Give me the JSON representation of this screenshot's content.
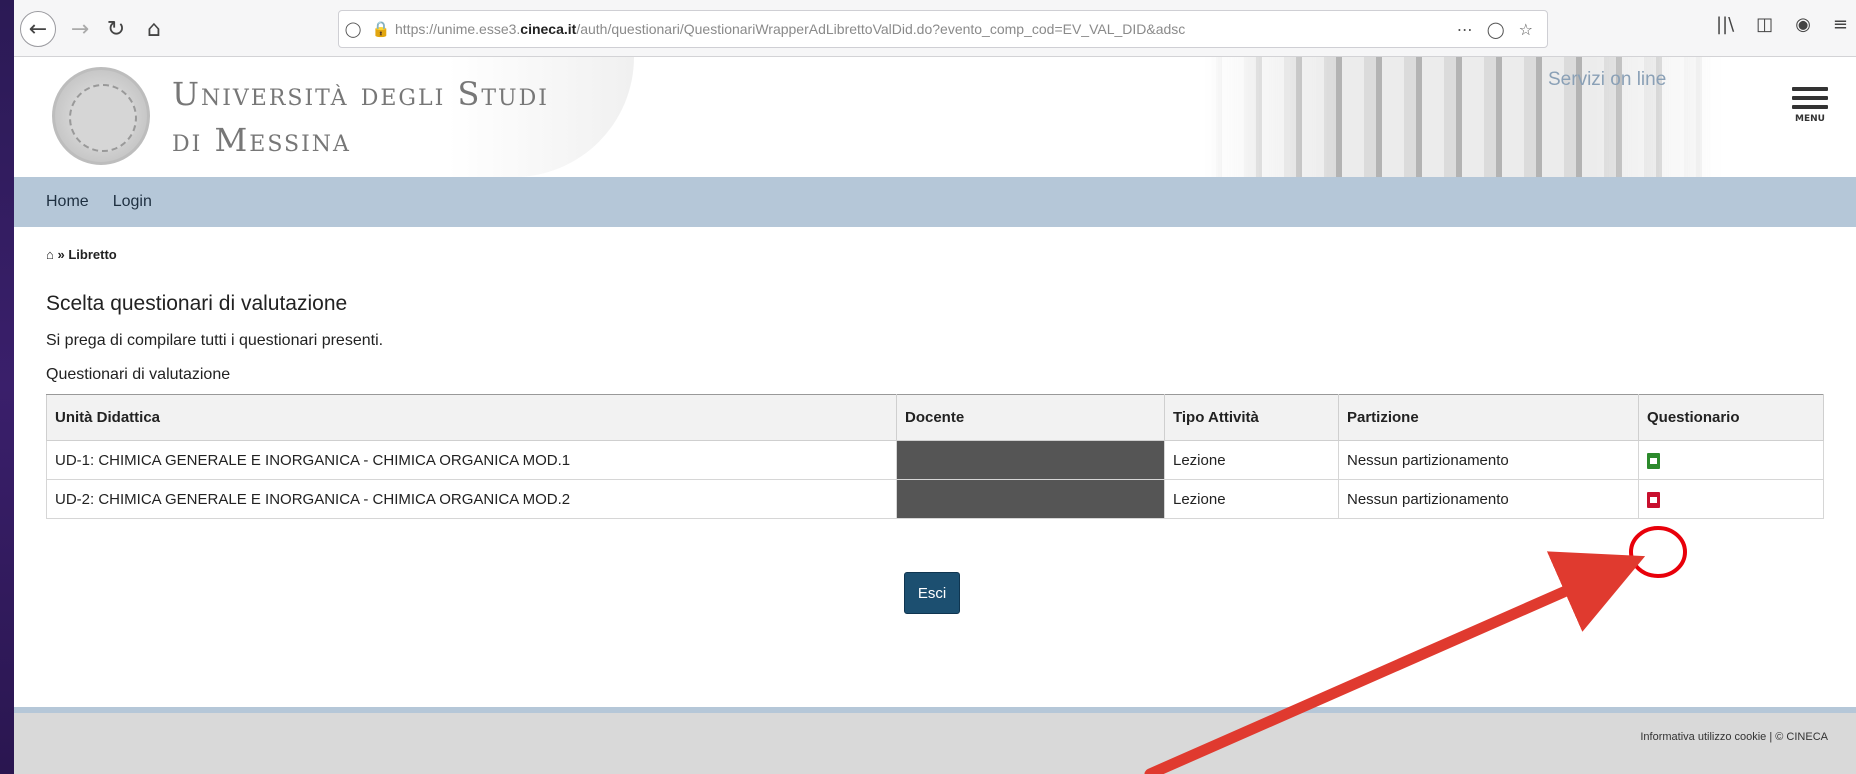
{
  "browser": {
    "url_prefix": "https://unime.esse3.",
    "url_domain": "cineca.it",
    "url_suffix": "/auth/questionari/QuestionariWrapperAdLibrettoValDid.do?evento_comp_cod=EV_VAL_DID&adsc",
    "icons": [
      "back-icon",
      "forward-icon",
      "reload-icon",
      "home-icon",
      "shield-icon",
      "lock-icon",
      "more-icon",
      "pocket-icon",
      "star-icon",
      "library-icon",
      "sidebar-icon",
      "account-icon",
      "hamburger-icon"
    ]
  },
  "header": {
    "univ_line1": "Università degli Studi",
    "univ_line2": "di Messina",
    "servizi": "Servizi on line",
    "menu_label": "MENU"
  },
  "nav": {
    "home": "Home",
    "login": "Login"
  },
  "breadcrumb": {
    "sep": "»",
    "current": "Libretto"
  },
  "main": {
    "title": "Scelta questionari di valutazione",
    "subtitle": "Si prega di compilare tutti i questionari presenti.",
    "section_label": "Questionari di valutazione",
    "table": {
      "headers": [
        "Unità Didattica",
        "Docente",
        "Tipo Attività",
        "Partizione",
        "Questionario"
      ],
      "rows": [
        {
          "ud": "UD-1: CHIMICA GENERALE E INORGANICA - CHIMICA ORGANICA MOD.1",
          "docente": "",
          "tipo": "Lezione",
          "partizione": "Nessun partizionamento",
          "status": "completed"
        },
        {
          "ud": "UD-2: CHIMICA GENERALE E INORGANICA - CHIMICA ORGANICA MOD.2",
          "docente": "",
          "tipo": "Lezione",
          "partizione": "Nessun partizionamento",
          "status": "to-fill"
        }
      ]
    },
    "exit_button": "Esci"
  },
  "footer": {
    "text": "Informativa utilizzo cookie | © CINECA"
  },
  "colors": {
    "navbar": "#b5c7d8",
    "button": "#1c4f70",
    "icon_completed": "#2c8a2c",
    "icon_todo": "#c8102e",
    "annotation": "#e03a2f"
  }
}
